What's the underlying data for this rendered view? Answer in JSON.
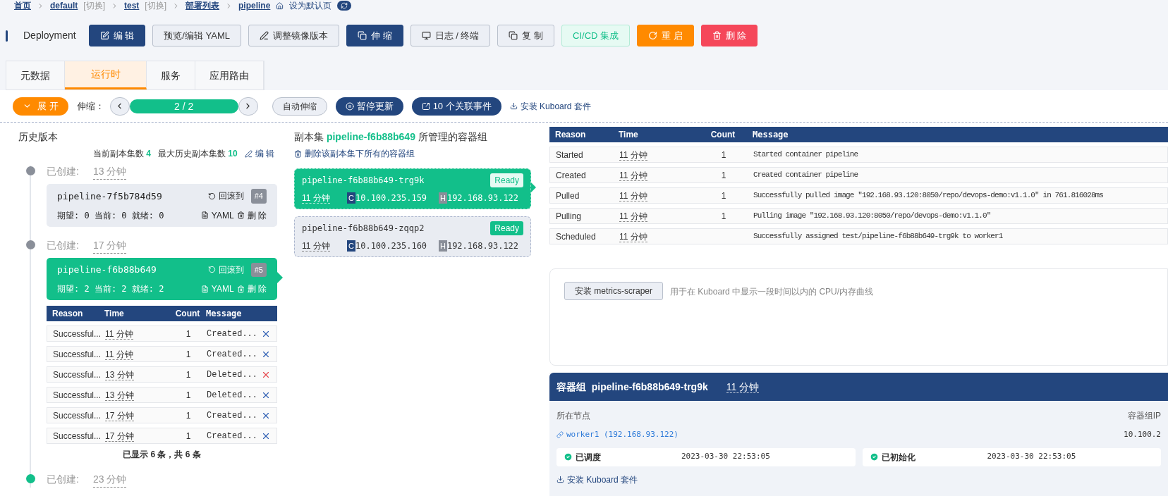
{
  "breadcrumb": {
    "items": [
      {
        "label": "首页"
      },
      {
        "label": "default",
        "switch": "[切换]"
      },
      {
        "label": "test",
        "switch": "[切换]"
      },
      {
        "label": "部署列表"
      },
      {
        "label": "pipeline"
      }
    ],
    "set_default": "设为默认页"
  },
  "header": {
    "kind_label": "Deployment",
    "buttons": [
      {
        "label": "编 辑",
        "kind": "primary"
      },
      {
        "label": "预览/编辑 YAML",
        "kind": "default"
      },
      {
        "label": "调整镜像版本",
        "kind": "default"
      },
      {
        "label": "伸 缩",
        "kind": "primary"
      },
      {
        "label": "日志 / 终端",
        "kind": "default"
      },
      {
        "label": "复 制",
        "kind": "default"
      },
      {
        "label": "CI/CD 集成",
        "kind": "cicd"
      },
      {
        "label": "重 启",
        "kind": "warning"
      },
      {
        "label": "删 除",
        "kind": "danger"
      }
    ]
  },
  "tabs": [
    {
      "label": "元数据",
      "selected": false
    },
    {
      "label": "运行时",
      "selected": true
    },
    {
      "label": "服务",
      "selected": false
    },
    {
      "label": "应用路由",
      "selected": false
    }
  ],
  "controls": {
    "expand": "展 开",
    "scale_label": "伸缩：",
    "scale_value": "2 / 2",
    "auto_scale": "自动伸缩",
    "pause": "暂停更新",
    "events": "10 个关联事件",
    "install": "安装 Kuboard 套件"
  },
  "history": {
    "title": "历史版本",
    "current_label": "当前副本集数",
    "current": "4",
    "max_label": "最大历史副本集数",
    "max": "10",
    "edit": "编 辑",
    "revisions": [
      {
        "created_label": "已创建:",
        "created": "13 分钟",
        "color": "#8a8f99",
        "name": "pipeline-7f5b784d59",
        "rollback": "回滚到",
        "revision": "#4",
        "desired": "期望: 0 当前: 0 就绪: 0",
        "yaml": "YAML",
        "delete": "删 除",
        "selected": false
      },
      {
        "created_label": "已创建:",
        "created": "17 分钟",
        "color": "#8a8f99",
        "name": "pipeline-f6b88b649",
        "rollback": "回滚到",
        "revision": "#5",
        "desired": "期望: 2 当前: 2 就绪: 2",
        "yaml": "YAML",
        "delete": "删 除",
        "selected": true,
        "events": {
          "columns": [
            "Reason",
            "Time",
            "Count",
            "Message"
          ],
          "rows": [
            {
              "reason": "Successful...",
              "time": "11 分钟",
              "count": "1",
              "message": "Created...",
              "color": "#2f5fb3"
            },
            {
              "reason": "Successful...",
              "time": "11 分钟",
              "count": "1",
              "message": "Created...",
              "color": "#2f5fb3"
            },
            {
              "reason": "Successful...",
              "time": "13 分钟",
              "count": "1",
              "message": "Deleted...",
              "color": "#e5484d"
            },
            {
              "reason": "Successful...",
              "time": "13 分钟",
              "count": "1",
              "message": "Deleted...",
              "color": "#2f5fb3"
            },
            {
              "reason": "Successful...",
              "time": "17 分钟",
              "count": "1",
              "message": "Created...",
              "color": "#2f5fb3"
            },
            {
              "reason": "Successful...",
              "time": "17 分钟",
              "count": "1",
              "message": "Created...",
              "color": "#2f5fb3"
            }
          ],
          "footer": "已显示 6 条，共 6 条"
        }
      },
      {
        "created_label": "已创建:",
        "created": "23 分钟",
        "color": "#12bf8a"
      }
    ]
  },
  "replicaset": {
    "prefix": "副本集",
    "name": "pipeline-f6b88b649",
    "suffix": "所管理的容器组",
    "delete_all": "删除该副本集下所有的容器组",
    "pods": [
      {
        "name": "pipeline-f6b88b649-trg9k",
        "status": "Ready",
        "age": "11 分钟",
        "container_badge": "C",
        "container_ip": "10.100.235.159",
        "host_badge": "H",
        "host_ip": "192.168.93.122",
        "selected": true
      },
      {
        "name": "pipeline-f6b88b649-zqqp2",
        "status": "Ready",
        "age": "11 分钟",
        "container_badge": "C",
        "container_ip": "10.100.235.160",
        "host_badge": "H",
        "host_ip": "192.168.93.122",
        "selected": false
      }
    ]
  },
  "pod_events": {
    "columns": [
      "Reason",
      "Time",
      "Count",
      "Message"
    ],
    "rows": [
      {
        "reason": "Started",
        "time": "11 分钟",
        "count": "1",
        "message": "Started container pipeline"
      },
      {
        "reason": "Created",
        "time": "11 分钟",
        "count": "1",
        "message": "Created container pipeline"
      },
      {
        "reason": "Pulled",
        "time": "11 分钟",
        "count": "1",
        "message": "Successfully pulled image \"192.168.93.120:8050/repo/devops-demo:v1.1.0\" in 761.816028ms"
      },
      {
        "reason": "Pulling",
        "time": "11 分钟",
        "count": "1",
        "message": "Pulling image \"192.168.93.120:8050/repo/devops-demo:v1.1.0\""
      },
      {
        "reason": "Scheduled",
        "time": "11 分钟",
        "message": "Successfully assigned test/pipeline-f6b88b649-trg9k to worker1"
      }
    ]
  },
  "metrics": {
    "button": "安装 metrics-scraper",
    "description": "用于在 Kuboard 中显示一段时间以内的 CPU/内存曲线"
  },
  "pod_detail": {
    "title_label": "容器组",
    "name": "pipeline-f6b88b649-trg9k",
    "age": "11 分钟",
    "node_label": "所在节点",
    "node": "worker1 (192.168.93.122)",
    "ip_label": "容器组IP",
    "ip": "10.100.2",
    "conditions": [
      {
        "label": "已调度",
        "time": "2023-03-30 22:53:05"
      },
      {
        "label": "已初始化",
        "time": "2023-03-30 22:53:05"
      }
    ],
    "install": "安装 Kuboard 套件"
  }
}
